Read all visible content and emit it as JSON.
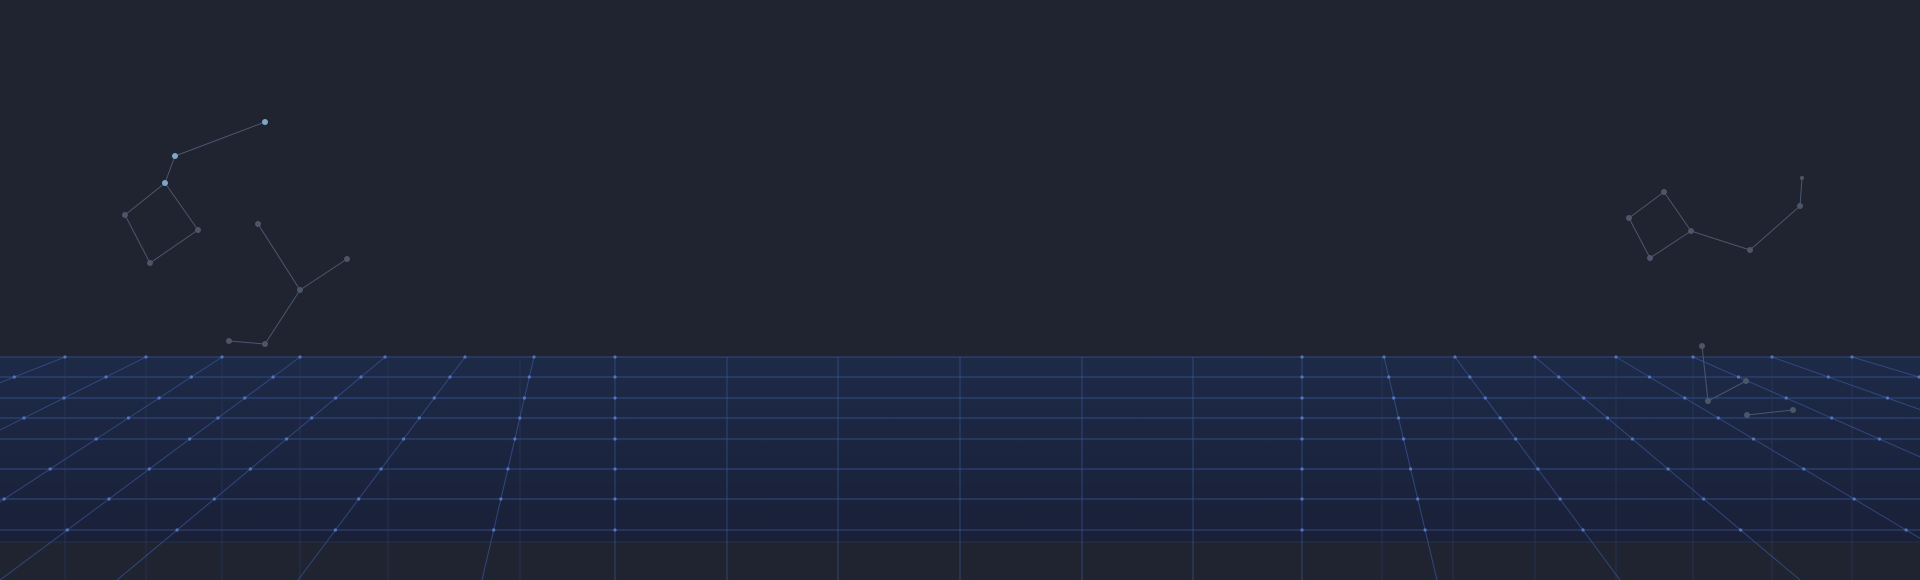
{
  "scene": {
    "colors": {
      "background": "#1f2430",
      "floor_top": "#1d2a47",
      "floor_bottom": "#1a2038",
      "grid_line": "#3a5aa0",
      "grid_line_dim": "#2e3f66",
      "grid_node": "#5a7fd0",
      "constellation_line": "#4a5770",
      "star_bright": "#7fa6c8",
      "star_dim": "#4d5668"
    },
    "icons": {
      "left_constellation": "constellation-icon",
      "right_constellation": "constellation-icon",
      "floor": "perspective-grid-icon"
    }
  }
}
